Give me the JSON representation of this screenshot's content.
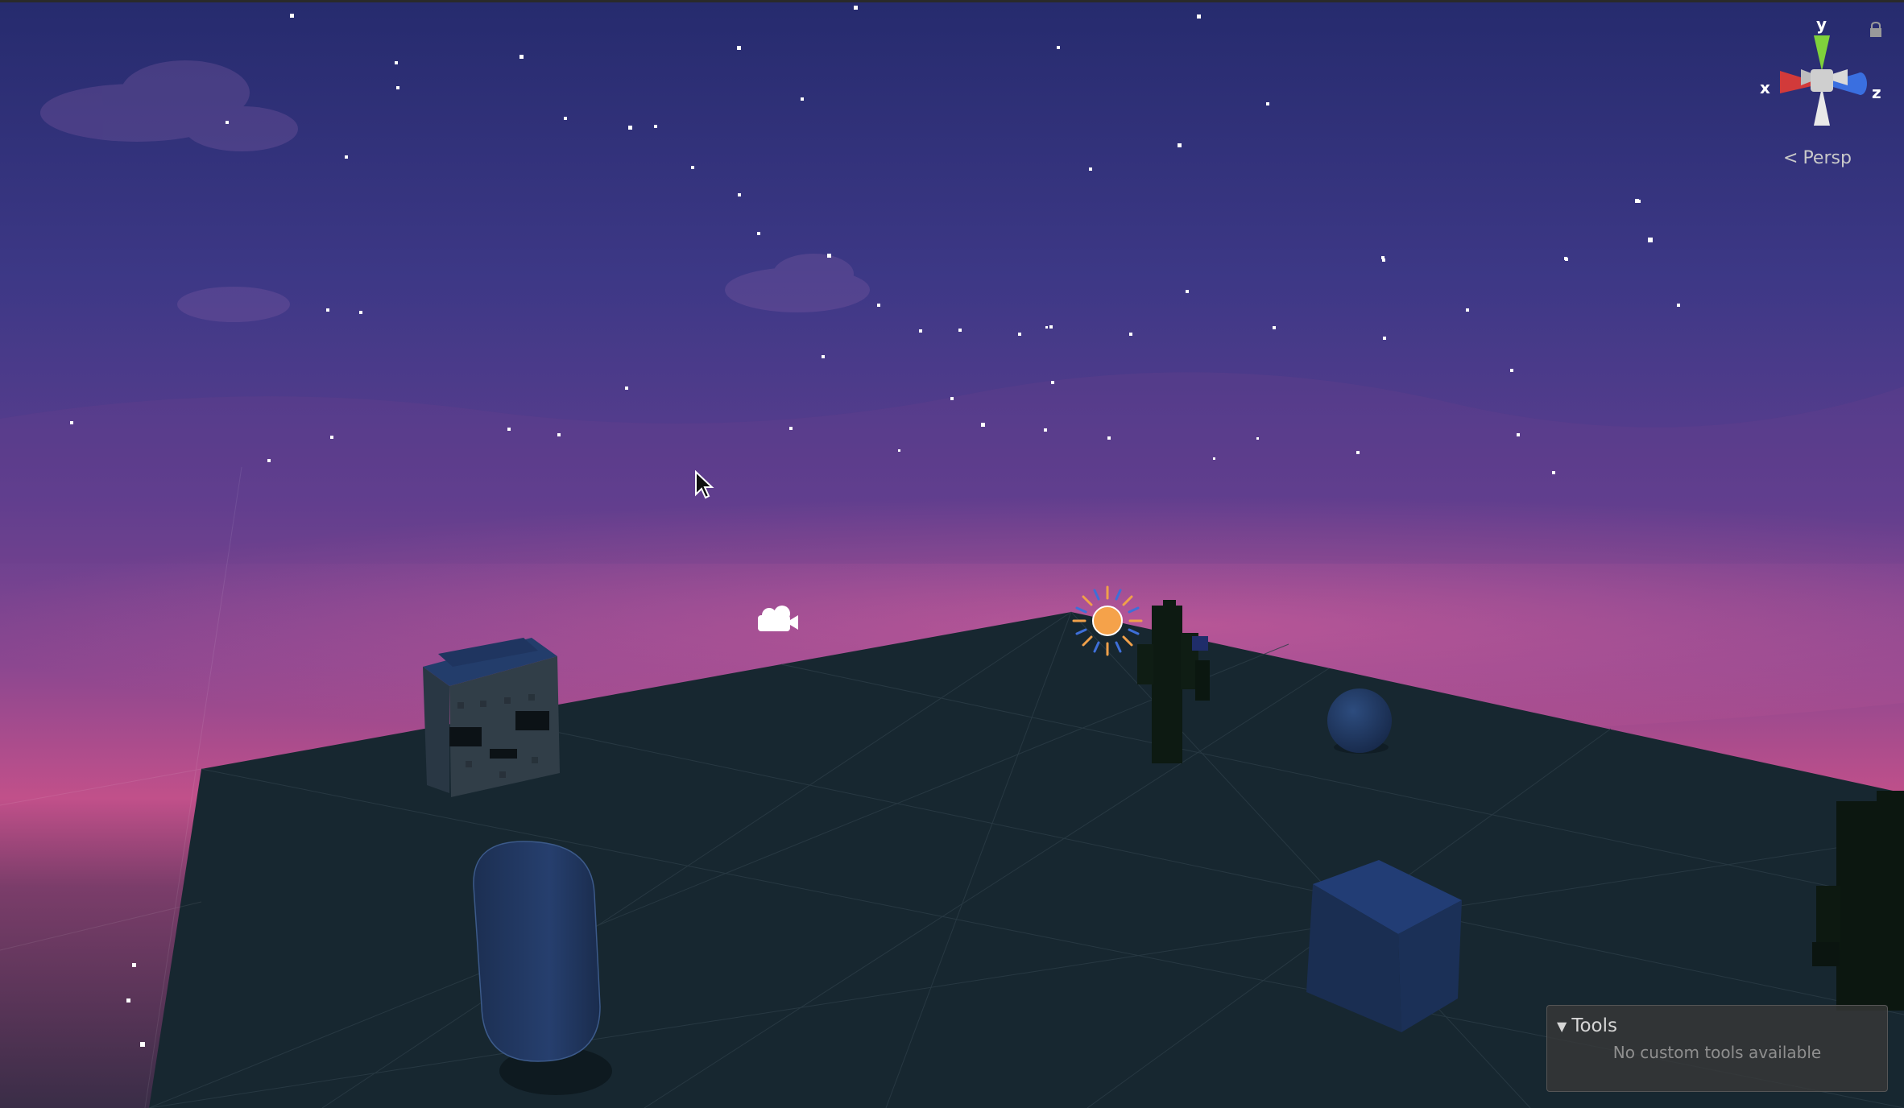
{
  "window": {
    "view": "Scene"
  },
  "scene_gizmo": {
    "axis_x": "x",
    "axis_y": "y",
    "axis_z": "z",
    "projection_label": "Persp",
    "colors": {
      "x": "#d23a3a",
      "y": "#7fd13b",
      "z": "#3a6fe0",
      "center": "#cfcfcf"
    }
  },
  "tools_overlay": {
    "title": "Tools",
    "empty_message": "No custom tools available"
  },
  "scene": {
    "sky_colors": [
      "#2b2f7a",
      "#4a3b8e",
      "#6b3f8e",
      "#b64b8c",
      "#d86891"
    ],
    "ground_color": "#17262d",
    "sun_color": "#f5a24a",
    "objects": [
      "directional-light-icon",
      "camera-icon",
      "skull-block",
      "cactus",
      "sphere",
      "capsule",
      "cube",
      "cactus-right"
    ]
  }
}
